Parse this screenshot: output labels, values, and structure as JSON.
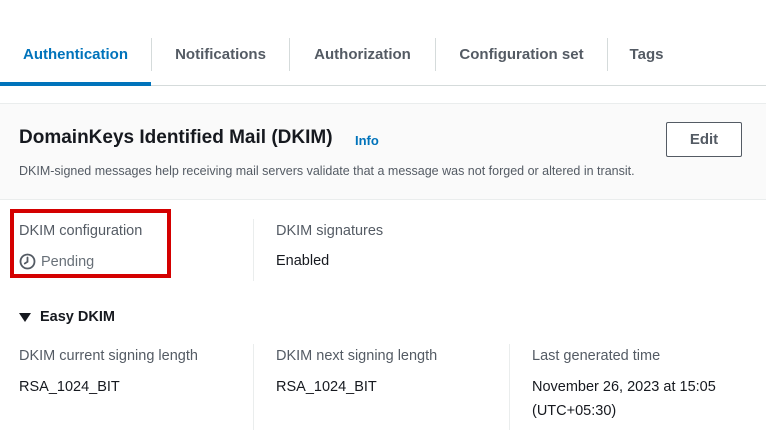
{
  "tabs": [
    {
      "label": "Authentication"
    },
    {
      "label": "Notifications"
    },
    {
      "label": "Authorization"
    },
    {
      "label": "Configuration set"
    },
    {
      "label": "Tags"
    }
  ],
  "panel": {
    "title": "DomainKeys Identified Mail (DKIM)",
    "info_label": "Info",
    "edit_label": "Edit",
    "description": "DKIM-signed messages help receiving mail servers validate that a message was not forged or altered in transit."
  },
  "dkim_configuration": {
    "label": "DKIM configuration",
    "value": "Pending",
    "status_icon": "clock-icon"
  },
  "dkim_signatures": {
    "label": "DKIM signatures",
    "value": "Enabled"
  },
  "easy_dkim": {
    "label": "Easy DKIM",
    "current_signing_length": {
      "label": "DKIM current signing length",
      "value": "RSA_1024_BIT"
    },
    "next_signing_length": {
      "label": "DKIM next signing length",
      "value": "RSA_1024_BIT"
    },
    "last_generated": {
      "label": "Last generated time",
      "value_line1": "November 26, 2023 at 15:05",
      "value_line2": "(UTC+05:30)"
    }
  },
  "colors": {
    "accent": "#0073bb",
    "highlight": "#d40000"
  }
}
